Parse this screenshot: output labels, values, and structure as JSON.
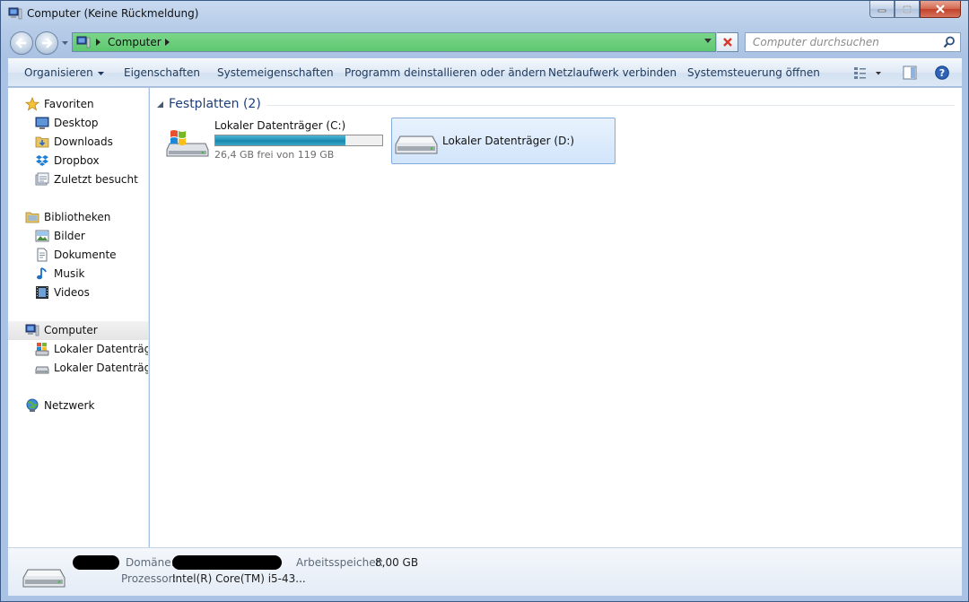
{
  "window": {
    "title": "Computer (Keine Rückmeldung)"
  },
  "address": {
    "crumb": "Computer",
    "search_placeholder": "Computer durchsuchen"
  },
  "toolbar": {
    "organize": "Organisieren",
    "properties": "Eigenschaften",
    "system_properties": "Systemeigenschaften",
    "uninstall": "Programm deinstallieren oder ändern",
    "map_drive": "Netzlaufwerk verbinden",
    "control_panel": "Systemsteuerung öffnen"
  },
  "sidebar": {
    "favorites": {
      "label": "Favoriten",
      "items": [
        "Desktop",
        "Downloads",
        "Dropbox",
        "Zuletzt besucht"
      ]
    },
    "libraries": {
      "label": "Bibliotheken",
      "items": [
        "Bilder",
        "Dokumente",
        "Musik",
        "Videos"
      ]
    },
    "computer": {
      "label": "Computer",
      "items": [
        "Lokaler Datenträger",
        "Lokaler Datenträger"
      ]
    },
    "network": {
      "label": "Netzwerk"
    }
  },
  "content": {
    "group_title": "Festplatten (2)",
    "drives": [
      {
        "name": "Lokaler Datenträger (C:)",
        "free_text": "26,4 GB frei von 119 GB",
        "used_fraction": 0.778
      },
      {
        "name": "Lokaler Datenträger (D:)"
      }
    ]
  },
  "details": {
    "domain_label": "Domäne:",
    "memory_label": "Arbeitsspeicher:",
    "memory_value": "8,00 GB",
    "cpu_label": "Prozessor:",
    "cpu_value": "Intel(R) Core(TM) i5-43..."
  },
  "colors": {
    "address_green": "#5ec870",
    "usage_fill": "#1f8fb5",
    "selection_blue": "#d2e5fb",
    "group_title": "#1e3f7a"
  }
}
